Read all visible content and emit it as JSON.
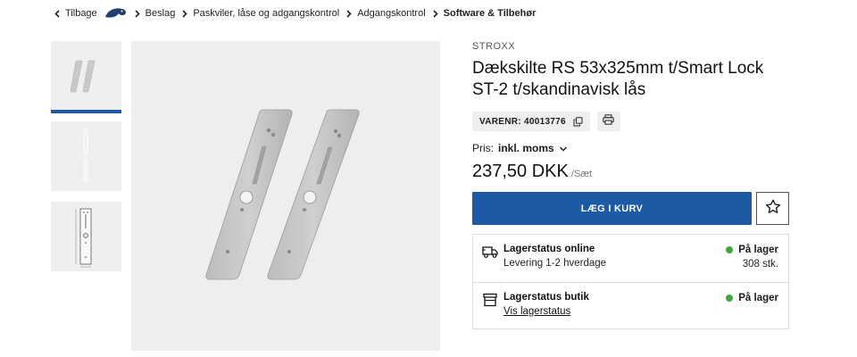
{
  "breadcrumb": {
    "back": "Tilbage",
    "items": [
      "Beslag",
      "Paskviler, låse og adgangskontrol",
      "Adgangskontrol"
    ],
    "current": "Software & Tilbehør"
  },
  "product": {
    "brand": "STROXX",
    "title_line1": "Dækskilte RS 53x325mm t/Smart Lock",
    "title_line2": "ST-2 t/skandinavisk lås",
    "sku_label": "VARENR: 40013776",
    "price_prefix": "Pris:",
    "price_mode": "inkl. moms",
    "price": "237,50 DKK",
    "price_unit": "/Sæt",
    "add_to_cart": "LÆG I KURV"
  },
  "stock": {
    "online": {
      "title": "Lagerstatus online",
      "sub": "Levering 1-2 hverdage",
      "status": "På lager",
      "qty": "308 stk."
    },
    "store": {
      "title": "Lagerstatus butik",
      "link": "Vis lagerstatus",
      "status": "På lager"
    }
  },
  "colors": {
    "accent": "#1d5aa6",
    "in_stock": "#3ea83a"
  },
  "icons": [
    "chevron-left-icon",
    "chevron-right-icon",
    "brand-logo",
    "copy-icon",
    "print-icon",
    "chevron-down-icon",
    "star-icon",
    "truck-icon",
    "store-icon"
  ]
}
